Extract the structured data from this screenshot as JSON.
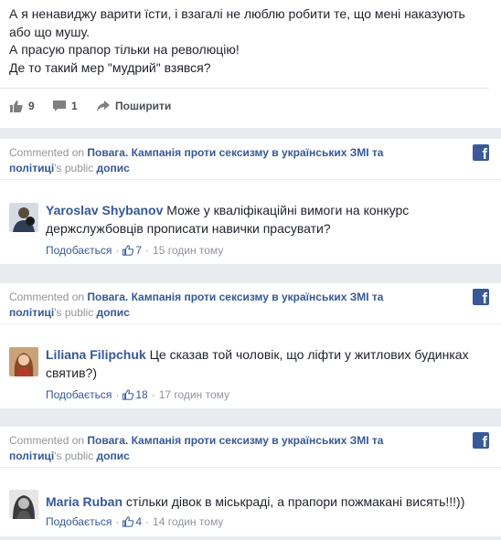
{
  "post": {
    "lines": [
      "А я ненавиджу варити їсти, і взагалі не люблю робити те, що мені наказують",
      "або що мушу.",
      "А прасую прапор тільки на революцію!",
      "Де то такий мер \"мудрий\" взявся?"
    ],
    "likes_count": "9",
    "comments_count": "1",
    "share_label": "Поширити"
  },
  "comments": [
    {
      "commented_on": "Commented on",
      "post_title": "Повага. Кампанія проти сексизму в українських ЗМІ та політиці",
      "possessive": "'s",
      "public": "public",
      "post_word": "допис",
      "author": "Yaroslav Shybanov",
      "text_line1": "Може у кваліфікаційні вимоги на конкурс",
      "text_line2": "держслужбовців прописати навички прасувати?",
      "like_label": "Подобається",
      "likes": "7",
      "time": "15 годин тому"
    },
    {
      "commented_on": "Commented on",
      "post_title": "Повага. Кампанія проти сексизму в українських ЗМІ та політиці",
      "possessive": "'s",
      "public": "public",
      "post_word": "допис",
      "author": "Liliana Filipchuk",
      "text_line1": "Це сказав той чоловік, що ліфти у житлових будинках",
      "text_line2": "святив?)",
      "like_label": "Подобається",
      "likes": "18",
      "time": "17 годин тому"
    },
    {
      "commented_on": "Commented on",
      "post_title": "Повага. Кампанія проти сексизму в українських ЗМІ та політиці",
      "possessive": "'s",
      "public": "public",
      "post_word": "допис",
      "author": "Maria Ruban",
      "text_line1": "стільки дівок в міськраді, а прапори пожмакані висять!!!))",
      "like_label": "Подобається",
      "likes": "4",
      "time": "14 годин тому"
    }
  ],
  "colors": {
    "link": "#365899",
    "muted": "#90949c",
    "facebook": "#3b5998",
    "feed_bg": "#e9ebee"
  },
  "icons": {
    "like": "thumbs-up-icon",
    "comment": "comment-bubble-icon",
    "share": "share-arrow-icon",
    "facebook": "facebook-logo-icon"
  }
}
